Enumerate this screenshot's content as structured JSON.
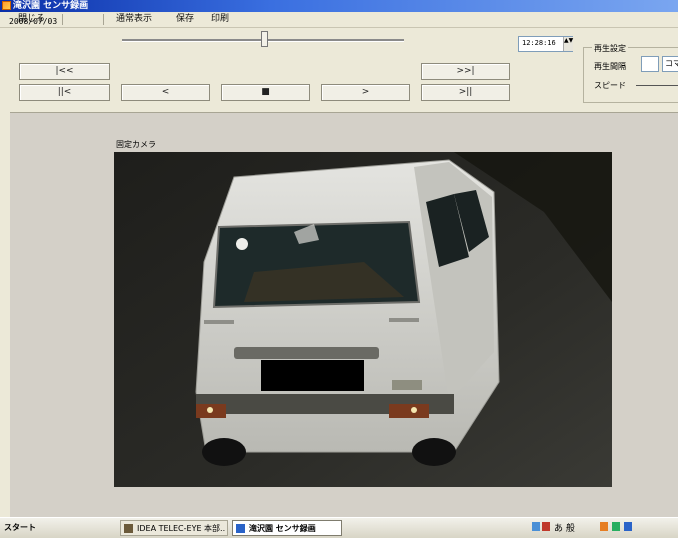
{
  "window": {
    "title": "滝沢園 センサ録画"
  },
  "menu": {
    "items": [
      "閉じる",
      "通常表示",
      "保存",
      "印刷"
    ]
  },
  "toolbar": {
    "date": "2008/07/03",
    "btn_first": "|<<",
    "btn_prev_frame": "||<",
    "btn_back": "<",
    "btn_stop": "■",
    "btn_forward": ">",
    "btn_last": ">>|",
    "btn_next_frame": ">||",
    "time": "12:28:16",
    "time_spin": "▲▼"
  },
  "playback_settings": {
    "title": "再生設定",
    "interval_label": "再生間隔",
    "interval_value": "",
    "interval_unit": "コマ",
    "speed_label": "スピード"
  },
  "camera": {
    "label": "固定カメラ",
    "plate_redacted": true
  },
  "taskbar": {
    "start_label": "スタート",
    "tasks": [
      "IDEA TELEC-EYE 本部..",
      "滝沢園 センサ録画"
    ],
    "tray_glyphs": "あ 般"
  },
  "colors": {
    "titlebar": "#0a2fa8",
    "window_bg": "#ece9d8",
    "view_bg": "#d4d0c8"
  }
}
